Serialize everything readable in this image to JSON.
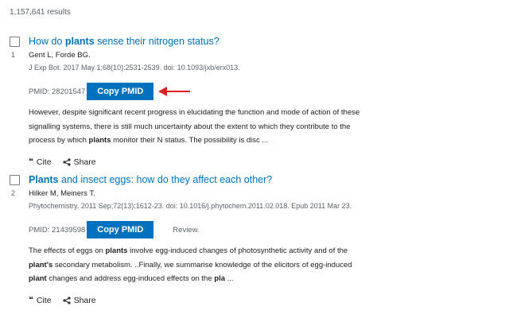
{
  "results": {
    "count_text": "1,157,641 results"
  },
  "articles": [
    {
      "number": "1",
      "title_parts": [
        "How do ",
        "plants",
        " sense their nitrogen status?"
      ],
      "authors": "Gent L, Forde BG.",
      "citation": "J Exp Bot. 2017 May 1;68(10):2531-2539. doi: 10.1093/jxb/erx013.",
      "pmid_label": "PMID: 28201547",
      "copy_button": "Copy PMID",
      "pub_type": "",
      "snippet_parts": [
        "However, despite significant recent progress in elucidating the function and mode of action of these signalling systems, there is still much uncertainty about the extent to which they contribute to the process by which ",
        "plants",
        " monitor their N status. The possibility is disc ..."
      ],
      "cite_label": "Cite",
      "share_label": "Share"
    },
    {
      "number": "2",
      "title_parts": [
        "Plants",
        " and insect eggs: how do they affect each other?"
      ],
      "authors": "Hilker M, Meiners T.",
      "citation": "Phytochemistry. 2011 Sep;72(13):1612-23. doi: 10.1016/j.phytochem.2011.02.018. Epub 2011 Mar 23.",
      "pmid_label": "PMID: 21439598",
      "copy_button": "Copy PMID",
      "pub_type": "Review.",
      "snippet_parts": [
        "The effects of eggs on ",
        "plants",
        " involve egg-induced changes of photosynthetic activity and of the ",
        "plant's",
        " secondary metabolism. ..Finally, we summarise knowledge of the elicitors of egg-induced ",
        "plant",
        " changes and address egg-induced effects on the ",
        "pla",
        " ..."
      ],
      "cite_label": "Cite",
      "share_label": "Share"
    }
  ],
  "colors": {
    "link": "#0071bc",
    "button_bg": "#0071bc",
    "annotation_arrow": "#e02020"
  },
  "icons": {
    "cite": "quote-icon",
    "share": "share-icon",
    "annotation": "red-arrow-icon"
  }
}
